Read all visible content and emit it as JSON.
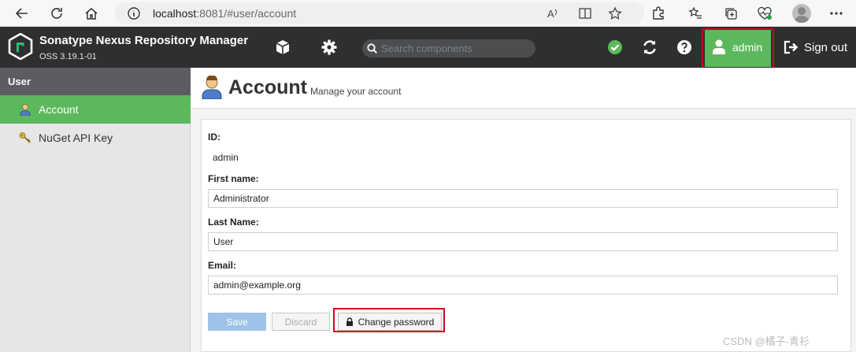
{
  "browser": {
    "url_host": "localhost",
    "url_rest": ":8081/#user/account"
  },
  "header": {
    "title": "Sonatype Nexus Repository Manager",
    "version": "OSS 3.19.1-01",
    "search_placeholder": "Search components",
    "user_label": "admin",
    "signout_label": "Sign out"
  },
  "sidebar": {
    "section": "User",
    "items": [
      {
        "label": "Account",
        "icon": "user-icon",
        "active": true
      },
      {
        "label": "NuGet API Key",
        "icon": "key-icon",
        "active": false
      }
    ]
  },
  "page": {
    "title": "Account",
    "subtitle": "Manage your account"
  },
  "form": {
    "id_label": "ID:",
    "id_value": "admin",
    "first_name_label": "First name:",
    "first_name_value": "Administrator",
    "last_name_label": "Last Name:",
    "last_name_value": "User",
    "email_label": "Email:",
    "email_value": "admin@example.org",
    "save_label": "Save",
    "discard_label": "Discard",
    "change_password_label": "Change password"
  },
  "watermark": "CSDN @橘子-青衫",
  "colors": {
    "accent": "#5cb85c",
    "header_bg": "#2d2f31",
    "highlight": "#d9001b",
    "save_disabled": "#9fc3e8"
  }
}
